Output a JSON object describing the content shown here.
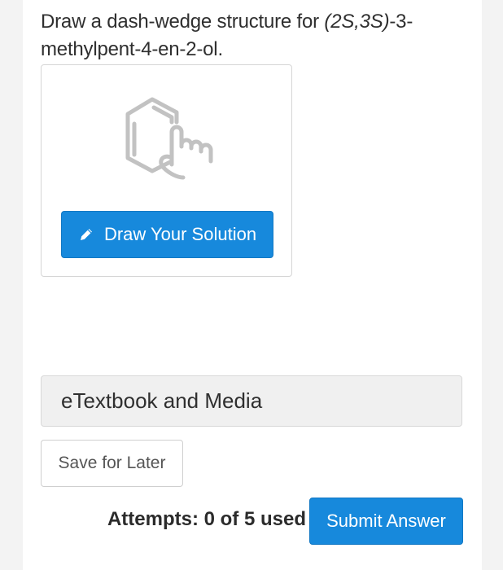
{
  "question": {
    "prefix": "Draw a dash-wedge structure for ",
    "stereo": "(2S,3S)",
    "suffix": "-3-methylpent-4-en-2-ol."
  },
  "draw_card": {
    "icon": "molecule-hand-icon",
    "button_icon": "pencil-icon",
    "button_label": "Draw Your Solution"
  },
  "media_bar": {
    "label": "eTextbook and Media"
  },
  "actions": {
    "save_label": "Save for Later",
    "attempts_text": "Attempts: 0 of 5 used",
    "submit_label": "Submit Answer"
  },
  "colors": {
    "primary": "#1789dc",
    "icon_gray": "#c2c2c2",
    "media_bg": "#f0f0f0"
  }
}
